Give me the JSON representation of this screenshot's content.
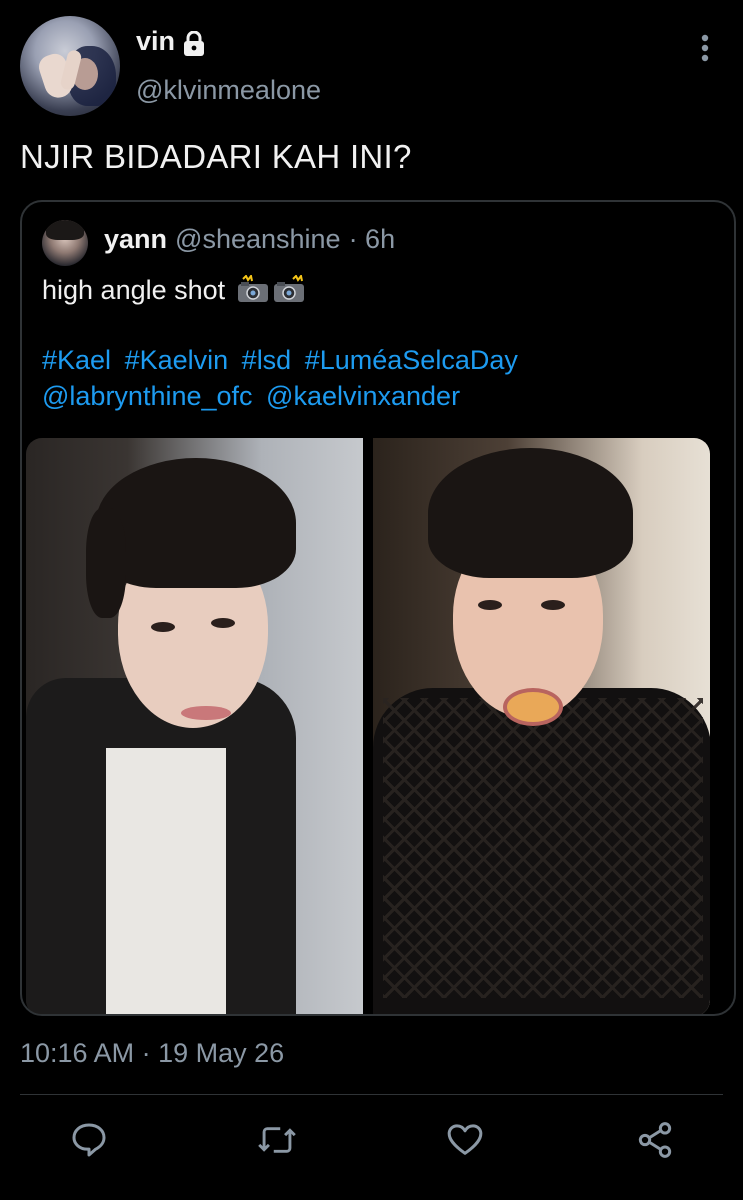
{
  "tweet": {
    "display_name": "vin",
    "handle": "@klvinmealone",
    "text": "NJIR BIDADARI KAH INI?",
    "timestamp": "10:16 AM · 19 May 26",
    "protected": true
  },
  "quote": {
    "display_name": "yann",
    "handle": "@sheanshine",
    "time": "· 6h",
    "text": "high angle shot",
    "emojis": [
      "camera-with-flash",
      "camera-with-flash"
    ],
    "hashtags": [
      "#Kael",
      "#Kaelvin",
      "#lsd",
      "#LuméaSelcaDay"
    ],
    "mentions": [
      "@labrynthine_ofc",
      "@kaelvinxander"
    ],
    "images": [
      "selfie-leather-jacket",
      "selfie-mesh-top"
    ]
  },
  "actions": [
    "reply-icon",
    "retweet-icon",
    "like-icon",
    "share-icon"
  ],
  "colors": {
    "background": "#000000",
    "text": "#e7e9ea",
    "secondary": "#8b98a5",
    "link": "#1d9bf0",
    "border": "#2f3336"
  }
}
